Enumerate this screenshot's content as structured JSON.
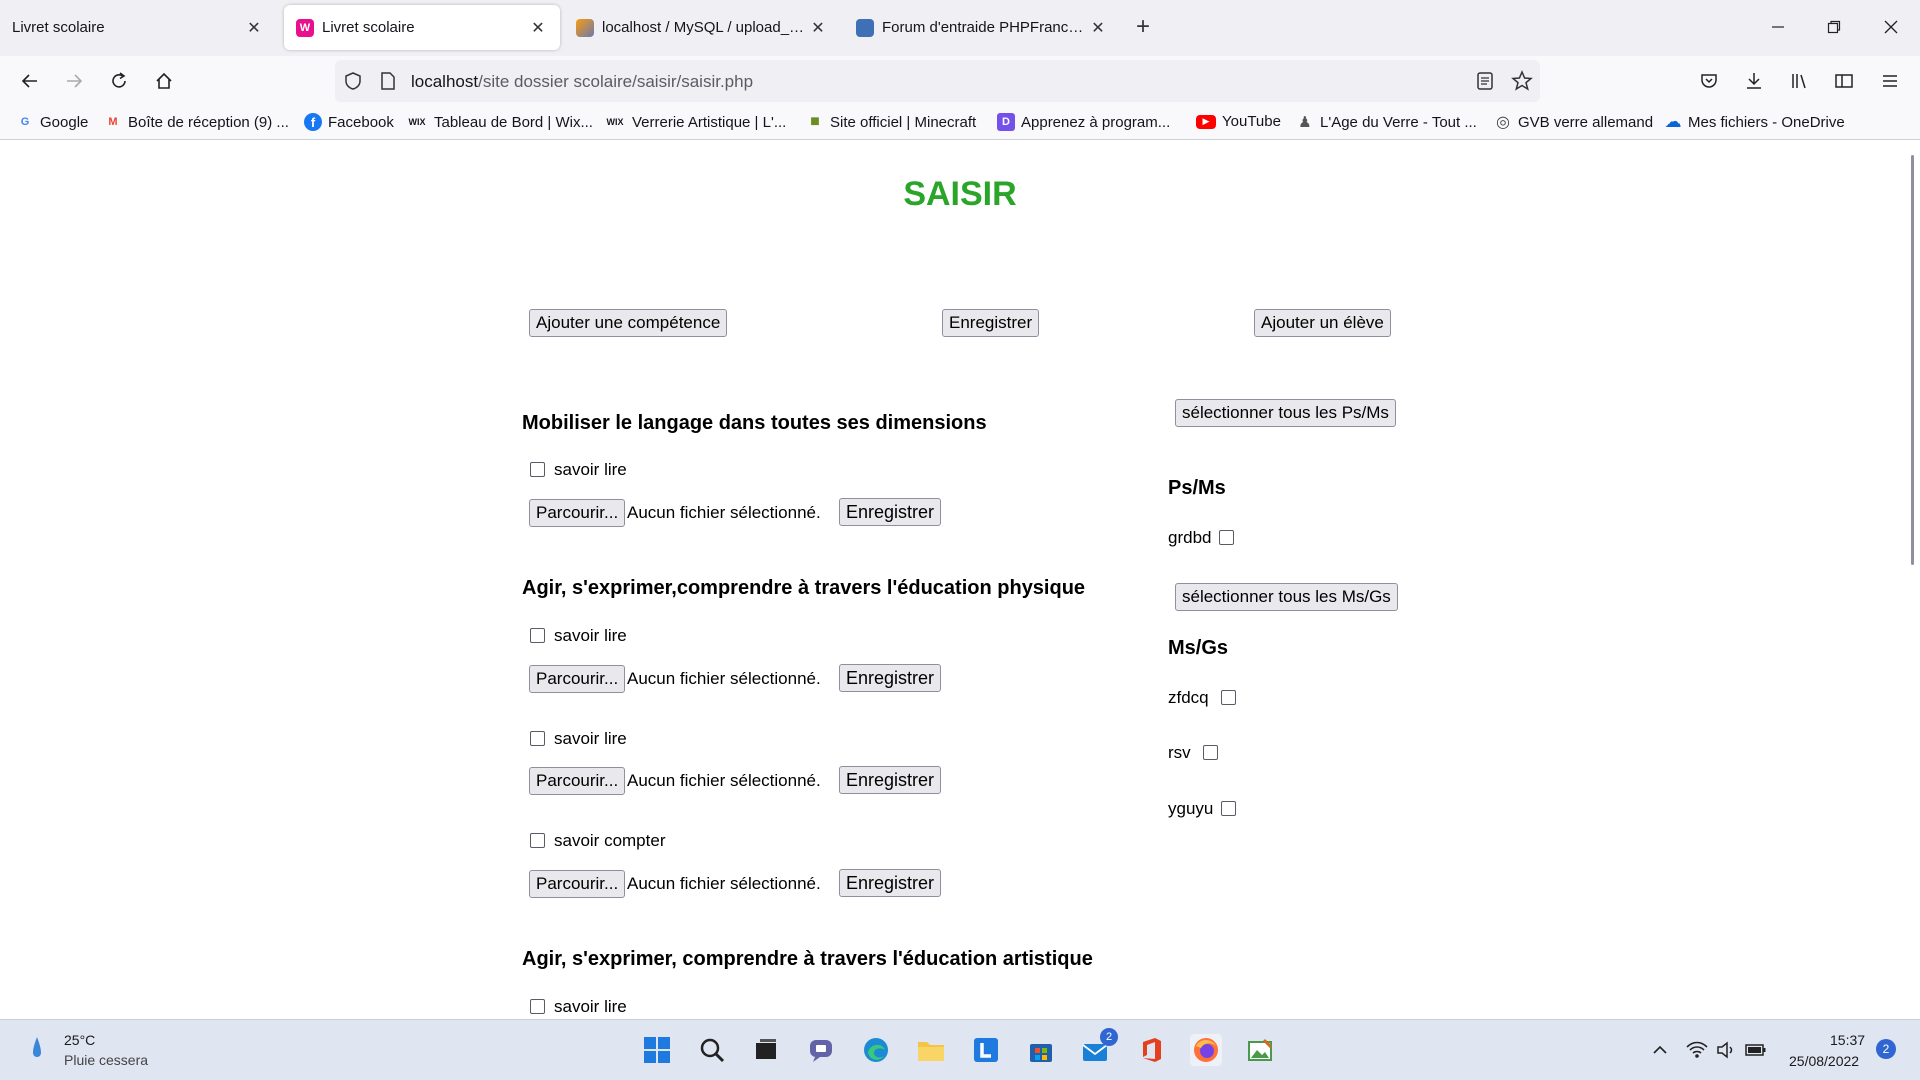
{
  "tabs": [
    {
      "label": "Livret scolaire",
      "close": "✕",
      "active": false
    },
    {
      "label": "Livret scolaire",
      "close": "✕",
      "active": true
    },
    {
      "label": "localhost / MySQL / upload_file",
      "close": "✕",
      "active": false
    },
    {
      "label": "Forum d'entraide PHPFrance - É",
      "close": "✕",
      "active": false
    }
  ],
  "newtab": "+",
  "url": {
    "host": "localhost",
    "path": "/site dossier scolaire/saisir/saisir.php"
  },
  "bookmarks": [
    {
      "label": "Google",
      "icon": "google-icon",
      "glyph": "G",
      "color": "#4285f4"
    },
    {
      "label": "Boîte de réception (9) ...",
      "icon": "gmail-icon",
      "glyph": "M",
      "color": "#ea4335"
    },
    {
      "label": "Facebook",
      "icon": "facebook-icon",
      "glyph": "f",
      "color": "#1877f2"
    },
    {
      "label": "Tableau de Bord | Wix...",
      "icon": "wix-icon",
      "glyph": "WIX",
      "color": "#000000"
    },
    {
      "label": "Verrerie Artistique | L'...",
      "icon": "wix-icon",
      "glyph": "WIX",
      "color": "#000000"
    },
    {
      "label": "Site officiel | Minecraft",
      "icon": "minecraft-icon",
      "glyph": "■",
      "color": "#6b8e23"
    },
    {
      "label": "Apprenez à program...",
      "icon": "openclassrooms-icon",
      "glyph": "D",
      "color": "#7451eb"
    },
    {
      "label": "YouTube",
      "icon": "youtube-icon",
      "glyph": "▶",
      "color": "#ff0000"
    },
    {
      "label": "L'Age du Verre - Tout ...",
      "icon": "glass-icon",
      "glyph": "♟",
      "color": "#555555"
    },
    {
      "label": "GVB verre allemand",
      "icon": "globe-icon",
      "glyph": "◎",
      "color": "#444444"
    },
    {
      "label": "Mes fichiers - OneDrive",
      "icon": "onedrive-icon",
      "glyph": "☁",
      "color": "#0a64d6"
    }
  ],
  "page": {
    "title": "SAISIR",
    "title_color": "#2aa52a",
    "top_buttons": {
      "add_skill": "Ajouter une compétence",
      "save": "Enregistrer",
      "add_student": "Ajouter un élève"
    },
    "browse_label": "Parcourir...",
    "no_file": "Aucun fichier sélectionné.",
    "save_label": "Enregistrer",
    "sections": [
      {
        "title": "Mobiliser le langage dans toutes ses dimensions",
        "items": [
          "savoir lire"
        ]
      },
      {
        "title": "Agir, s'exprimer,comprendre à travers l'éducation physique",
        "items": [
          "savoir lire",
          "savoir lire",
          "savoir compter"
        ]
      },
      {
        "title": "Agir, s'exprimer, comprendre à travers l'éducation artistique",
        "items": [
          "savoir lire"
        ]
      }
    ],
    "groups": [
      {
        "select_all": "sélectionner tous les Ps/Ms",
        "title": "Ps/Ms",
        "students": [
          "grdbd"
        ]
      },
      {
        "select_all": "sélectionner tous les Ms/Gs",
        "title": "Ms/Gs",
        "students": [
          "zfdcq",
          "rsv",
          "yguyu"
        ]
      }
    ]
  },
  "taskbar": {
    "weather_temp": "25°C",
    "weather_desc": "Pluie cessera",
    "mail_badge": "2",
    "time": "15:37",
    "date": "25/08/2022",
    "notif_count": "2"
  }
}
